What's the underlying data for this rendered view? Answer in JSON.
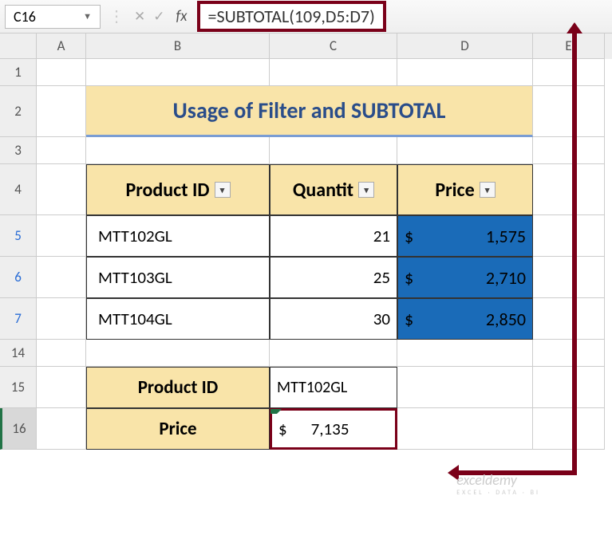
{
  "namebox": "C16",
  "formula": "=SUBTOTAL(109,D5:D7)",
  "columns": {
    "A": "A",
    "B": "B",
    "C": "C",
    "D": "D",
    "E": "E"
  },
  "rows": {
    "r1": "1",
    "r2": "2",
    "r3": "3",
    "r4": "4",
    "r5": "5",
    "r6": "6",
    "r7": "7",
    "r14": "14",
    "r15": "15",
    "r16": "16"
  },
  "title": "Usage of Filter and SUBTOTAL",
  "headers": {
    "pid": "Product ID",
    "qty": "Quantit",
    "price": "Price"
  },
  "data": [
    {
      "pid": "MTT102GL",
      "qty": "21",
      "cur": "$",
      "price": "1,575"
    },
    {
      "pid": "MTT103GL",
      "qty": "25",
      "cur": "$",
      "price": "2,710"
    },
    {
      "pid": "MTT104GL",
      "qty": "30",
      "cur": "$",
      "price": "2,850"
    }
  ],
  "sum": {
    "pid_lbl": "Product ID",
    "pid_val": "MTT102GL",
    "price_lbl": "Price",
    "cur": "$",
    "total": "7,135"
  },
  "watermark": {
    "main": "exceldemy",
    "sub": "EXCEL · DATA · BI"
  }
}
